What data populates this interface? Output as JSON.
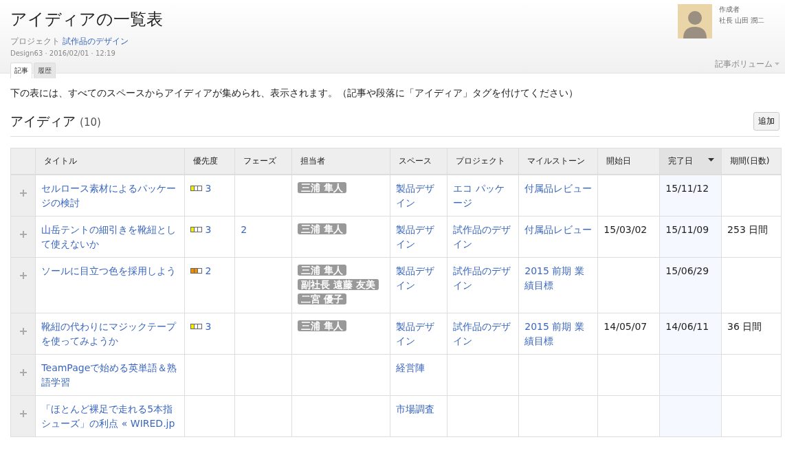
{
  "header": {
    "title": "アイディアの一覧表",
    "project_label": "プロジェクト",
    "project_link": "試作品のデザイン",
    "meta": "Design63 · 2016/02/01 · 12:19",
    "author_label": "作成者",
    "author_name": "社長 山田 潤二"
  },
  "tabs": [
    {
      "label": "記事",
      "selected": true
    },
    {
      "label": "履歴",
      "selected": false
    }
  ],
  "volume_menu": "記事ボリューム",
  "intro": "下の表には、すべてのスペースからアイディアが集められ、表示されます。（記事や段落に「アイディア」タグを付けてください）",
  "section": {
    "title": "アイディア",
    "count": "(10)",
    "add_button": "追加"
  },
  "table": {
    "columns": [
      {
        "label": "タイトル",
        "sorted": false
      },
      {
        "label": "優先度",
        "sorted": false
      },
      {
        "label": "フェーズ",
        "sorted": false
      },
      {
        "label": "担当者",
        "sorted": false
      },
      {
        "label": "スペース",
        "sorted": false
      },
      {
        "label": "プロジェクト",
        "sorted": false
      },
      {
        "label": "マイルストーン",
        "sorted": false
      },
      {
        "label": "開始日",
        "sorted": false
      },
      {
        "label": "完了日",
        "sorted": true
      },
      {
        "label": "期間(日数)",
        "sorted": false
      }
    ],
    "rows": [
      {
        "title": "セルロース素材によるパッケージの検討",
        "priority": {
          "value": "3",
          "level": 0.3333,
          "color": "#f5ee00"
        },
        "phase": "",
        "assignees": [
          "三浦 隼人"
        ],
        "space": "製品デザイン",
        "project": "エコ パッケージ",
        "milestone": "付属品レビュー",
        "start": "",
        "end": "15/11/12",
        "period": ""
      },
      {
        "title": "山岳テントの細引きを靴紐として使えないか",
        "priority": {
          "value": "3",
          "level": 0.3333,
          "color": "#f5ee00"
        },
        "phase": "2",
        "assignees": [
          "三浦 隼人"
        ],
        "space": "製品デザイン",
        "project": "試作品のデザイン",
        "milestone": "付属品レビュー",
        "start": "15/03/02",
        "end": "15/11/09",
        "period": "253 日間"
      },
      {
        "title": "ソールに目立つ色を採用しよう",
        "priority": {
          "value": "2",
          "level": 0.6667,
          "color": "#f08c00"
        },
        "phase": "",
        "assignees": [
          "三浦 隼人",
          "副社長 遠藤 友美",
          "二宮 優子"
        ],
        "space": "製品デザイン",
        "project": "試作品のデザイン",
        "milestone": "2015 前期 業績目標",
        "start": "",
        "end": "15/06/29",
        "period": ""
      },
      {
        "title": "靴紐の代わりにマジックテープを使ってみようか",
        "priority": {
          "value": "3",
          "level": 0.3333,
          "color": "#f5ee00"
        },
        "phase": "",
        "assignees": [
          "三浦 隼人"
        ],
        "space": "製品デザイン",
        "project": "試作品のデザイン",
        "milestone": "2015 前期 業績目標",
        "start": "14/05/07",
        "end": "14/06/11",
        "period": "36 日間"
      },
      {
        "title": "TeamPageで始める英単語＆熟語学習",
        "priority": null,
        "phase": "",
        "assignees": [],
        "space": "経営陣",
        "project": "",
        "milestone": "",
        "start": "",
        "end": "",
        "period": ""
      },
      {
        "title": "「ほとんど裸足で走れる5本指シューズ」の利点 « WIRED.jp",
        "priority": null,
        "phase": "",
        "assignees": [],
        "space": "市場調査",
        "project": "",
        "milestone": "",
        "start": "",
        "end": "",
        "period": ""
      }
    ]
  }
}
